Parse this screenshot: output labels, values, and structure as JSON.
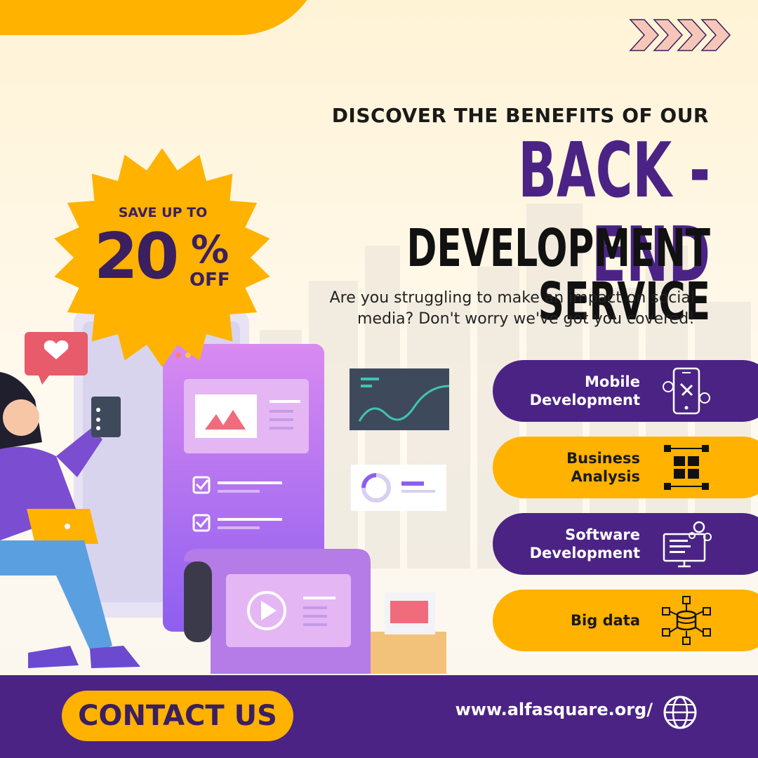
{
  "headline": {
    "line1": "DISCOVER THE BENEFITS OF OUR",
    "line2": "BACK -END",
    "line3": "DEVELOPMENT SERVICE"
  },
  "subtitle": "Are you struggling to make an impact on social media? Don't worry we've got you covered!",
  "badge": {
    "save": "SAVE UP TO",
    "number": "20",
    "percent": "%",
    "off": "OFF"
  },
  "services": [
    {
      "label": "Mobile\nDevelopment",
      "icon": "mobile-gear-icon",
      "style": "purple"
    },
    {
      "label": "Business\nAnalysis",
      "icon": "puzzle-nodes-icon",
      "style": "orange"
    },
    {
      "label": "Software\nDevelopment",
      "icon": "monitor-gears-icon",
      "style": "purple"
    },
    {
      "label": "Big data",
      "icon": "database-network-icon",
      "style": "orange"
    }
  ],
  "footer": {
    "contact_label": "CONTACT US",
    "url": "www.alfasquare.org/"
  },
  "colors": {
    "purple": "#4b2384",
    "orange": "#ffb200",
    "cream": "#fffaf0"
  }
}
